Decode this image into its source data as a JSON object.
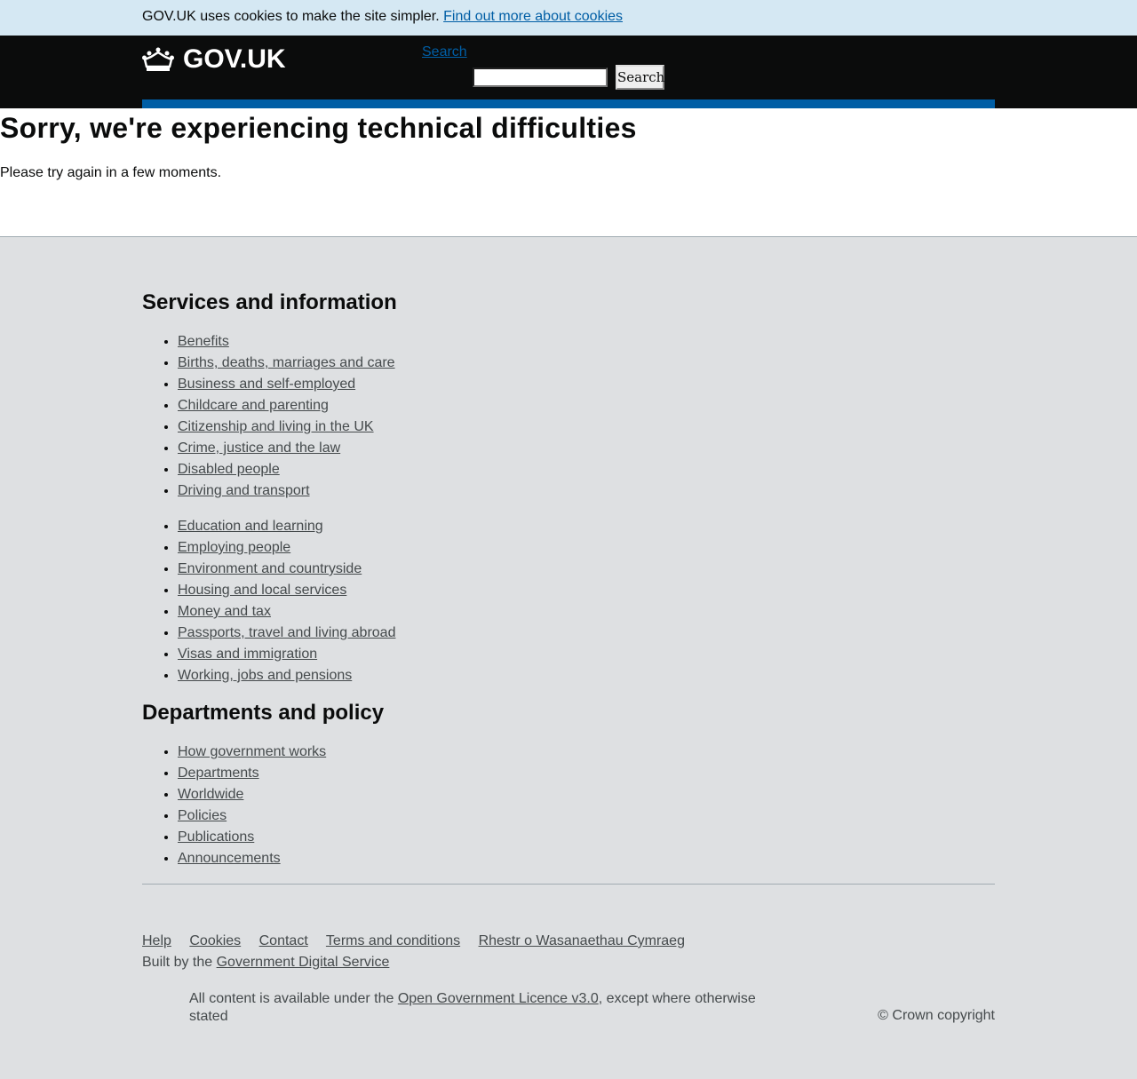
{
  "cookie_banner": {
    "text": "GOV.UK uses cookies to make the site simpler.",
    "link": "Find out more about cookies"
  },
  "header": {
    "logo_text": "GOV.UK",
    "search_link": "Search",
    "search_button": "Search",
    "accent_color": "#005ea5"
  },
  "main": {
    "title": "Sorry, we're experiencing technical difficulties",
    "message": "Please try again in a few moments."
  },
  "footer": {
    "services_heading": "Services and information",
    "services_col1": [
      "Benefits",
      "Births, deaths, marriages and care",
      "Business and self-employed",
      "Childcare and parenting",
      "Citizenship and living in the UK",
      "Crime, justice and the law",
      "Disabled people",
      "Driving and transport"
    ],
    "services_col2": [
      "Education and learning",
      "Employing people",
      "Environment and countryside",
      "Housing and local services",
      "Money and tax",
      "Passports, travel and living abroad",
      "Visas and immigration",
      "Working, jobs and pensions"
    ],
    "departments_heading": "Departments and policy",
    "departments": [
      "How government works",
      "Departments",
      "Worldwide",
      "Policies",
      "Publications",
      "Announcements"
    ],
    "meta_links": [
      "Help",
      "Cookies",
      "Contact",
      "Terms and conditions",
      "Rhestr o Wasanaethau Cymraeg"
    ],
    "built_by_text": "Built by the",
    "built_by_link": "Government Digital Service",
    "licence_prefix": "All content is available under the",
    "licence_link": "Open Government Licence v3.0",
    "licence_suffix": ", except where otherwise stated",
    "copyright": "© Crown copyright"
  }
}
